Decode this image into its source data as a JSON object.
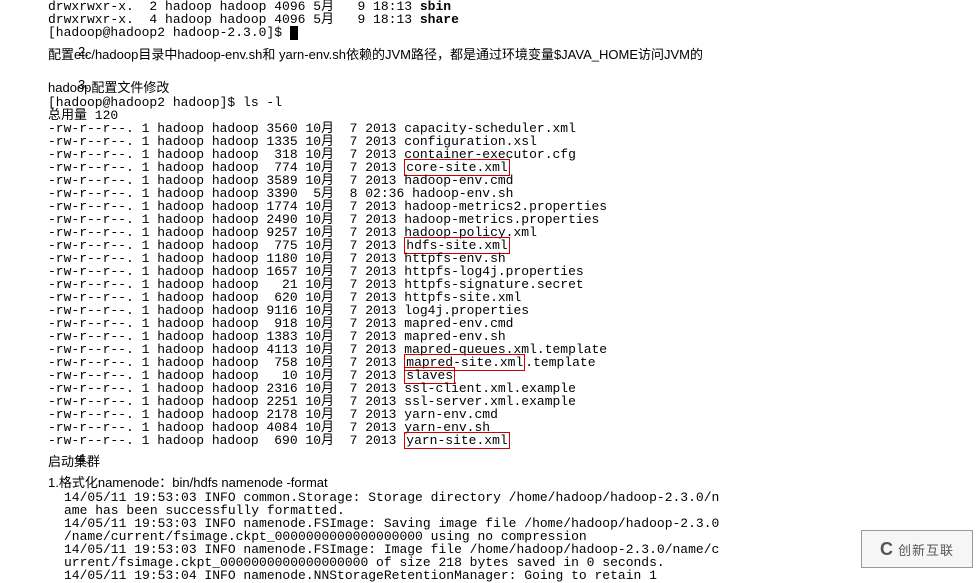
{
  "top_ls": {
    "line1_pre": "drwxrwxr-x.  2 hadoop hadoop 4096 5月   9 18:13 ",
    "line1_name": "sbin",
    "line2_pre": "drwxrwxr-x.  4 hadoop hadoop 4096 5月   9 18:13 ",
    "line2_name": "share",
    "prompt": "[hadoop@hadoop2 hadoop-2.3.0]$ "
  },
  "item2": {
    "num": "2.",
    "text": "配置etc/hadoop目录中hadoop-env.sh和 yarn-env.sh依赖的JVM路径，都是通过环境变量$JAVA_HOME访问JVM的"
  },
  "item3": {
    "num": "3.",
    "text": "hadoop配置文件修改",
    "prompt": "[hadoop@hadoop2 hadoop]$ ls -l",
    "total": "总用量 120",
    "lines": [
      {
        "pre": "-rw-r--r--. 1 hadoop hadoop 3560 10月  7 2013 ",
        "name": "capacity-scheduler.xml"
      },
      {
        "pre": "-rw-r--r--. 1 hadoop hadoop 1335 10月  7 2013 ",
        "name": "configuration.xsl"
      },
      {
        "pre": "-rw-r--r--. 1 hadoop hadoop  318 10月  7 2013 ",
        "name": "container-executor.cfg"
      },
      {
        "pre": "-rw-r--r--. 1 hadoop hadoop  774 10月  7 2013 ",
        "name": "core-site.xml",
        "boxed": true
      },
      {
        "pre": "-rw-r--r--. 1 hadoop hadoop 3589 10月  7 2013 ",
        "name": "hadoop-env.cmd"
      },
      {
        "pre": "-rw-r--r--. 1 hadoop hadoop 3390  5月  8 02:36 ",
        "name": "hadoop-env.sh"
      },
      {
        "pre": "-rw-r--r--. 1 hadoop hadoop 1774 10月  7 2013 ",
        "name": "hadoop-metrics2.properties"
      },
      {
        "pre": "-rw-r--r--. 1 hadoop hadoop 2490 10月  7 2013 ",
        "name": "hadoop-metrics.properties"
      },
      {
        "pre": "-rw-r--r--. 1 hadoop hadoop 9257 10月  7 2013 ",
        "name": "hadoop-policy.xml"
      },
      {
        "pre": "-rw-r--r--. 1 hadoop hadoop  775 10月  7 2013 ",
        "name": "hdfs-site.xml",
        "boxed": true
      },
      {
        "pre": "-rw-r--r--. 1 hadoop hadoop 1180 10月  7 2013 ",
        "name": "httpfs-env.sh"
      },
      {
        "pre": "-rw-r--r--. 1 hadoop hadoop 1657 10月  7 2013 ",
        "name": "httpfs-log4j.properties"
      },
      {
        "pre": "-rw-r--r--. 1 hadoop hadoop   21 10月  7 2013 ",
        "name": "httpfs-signature.secret"
      },
      {
        "pre": "-rw-r--r--. 1 hadoop hadoop  620 10月  7 2013 ",
        "name": "httpfs-site.xml"
      },
      {
        "pre": "-rw-r--r--. 1 hadoop hadoop 9116 10月  7 2013 ",
        "name": "log4j.properties"
      },
      {
        "pre": "-rw-r--r--. 1 hadoop hadoop  918 10月  7 2013 ",
        "name": "mapred-env.cmd"
      },
      {
        "pre": "-rw-r--r--. 1 hadoop hadoop 1383 10月  7 2013 ",
        "name": "mapred-env.sh"
      },
      {
        "pre": "-rw-r--r--. 1 hadoop hadoop 4113 10月  7 2013 ",
        "name": "mapred-queues.xml.template"
      },
      {
        "pre": "-rw-r--r--. 1 hadoop hadoop  758 10月  7 2013 ",
        "name": "mapred-site.xml",
        "boxed": true,
        "suffix": ".template"
      },
      {
        "pre": "-rw-r--r--. 1 hadoop hadoop   10 10月  7 2013 ",
        "name": "slaves",
        "boxed": true
      },
      {
        "pre": "-rw-r--r--. 1 hadoop hadoop 2316 10月  7 2013 ",
        "name": "ssl-client.xml.example"
      },
      {
        "pre": "-rw-r--r--. 1 hadoop hadoop 2251 10月  7 2013 ",
        "name": "ssl-server.xml.example"
      },
      {
        "pre": "-rw-r--r--. 1 hadoop hadoop 2178 10月  7 2013 ",
        "name": "yarn-env.cmd"
      },
      {
        "pre": "-rw-r--r--. 1 hadoop hadoop 4084 10月  7 2013 ",
        "name": "yarn-env.sh"
      },
      {
        "pre": "-rw-r--r--. 1 hadoop hadoop  690 10月  7 2013 ",
        "name": "yarn-site.xml",
        "boxed": true
      }
    ]
  },
  "item4": {
    "num": "4.",
    "text": "启动集群",
    "sub1": "1.格式化namenode：bin/hdfs namenode -format",
    "logs": [
      "14/05/11 19:53:03 INFO common.Storage: Storage directory /home/hadoop/hadoop-2.3.0/n",
      "ame has been successfully formatted.",
      "14/05/11 19:53:03 INFO namenode.FSImage: Saving image file /home/hadoop/hadoop-2.3.0",
      "/name/current/fsimage.ckpt_0000000000000000000 using no compression",
      "14/05/11 19:53:03 INFO namenode.FSImage: Image file /home/hadoop/hadoop-2.3.0/name/c",
      "urrent/fsimage.ckpt_0000000000000000000 of size 218 bytes saved in 0 seconds.",
      "14/05/11 19:53:04 INFO namenode.NNStorageRetentionManager: Going to retain 1"
    ]
  },
  "watermark": {
    "logo": "C",
    "text": "创新互联"
  }
}
